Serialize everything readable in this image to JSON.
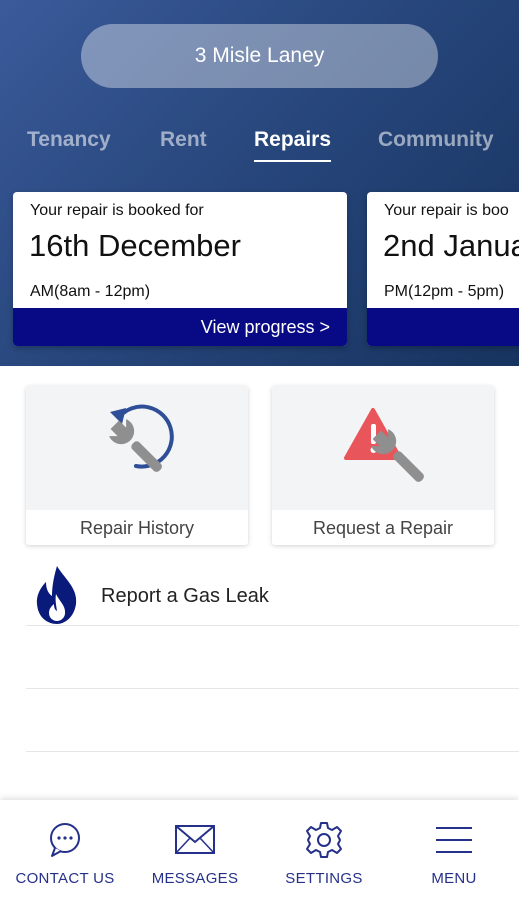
{
  "header": {
    "address": "3 Misle Laney"
  },
  "tabs": [
    {
      "label": "Tenancy",
      "active": false
    },
    {
      "label": "Rent",
      "active": false
    },
    {
      "label": "Repairs",
      "active": true
    },
    {
      "label": "Community",
      "active": false
    }
  ],
  "bookings": [
    {
      "label": "Your repair is booked for",
      "date": "16th December",
      "slot": "AM(8am - 12pm)",
      "action": "View progress >"
    },
    {
      "label": "Your repair is boo",
      "date": "2nd Janua",
      "slot": "PM(12pm - 5pm)",
      "action": ""
    }
  ],
  "tiles": [
    {
      "label": "Repair History",
      "icon": "repair-history-icon"
    },
    {
      "label": "Request a Repair",
      "icon": "request-repair-icon"
    }
  ],
  "list": [
    {
      "label": "Report a Gas Leak",
      "icon": "flame-icon"
    }
  ],
  "bottom_nav": [
    {
      "label": "CONTACT US",
      "icon": "chat-bubble-icon"
    },
    {
      "label": "MESSAGES",
      "icon": "envelope-icon"
    },
    {
      "label": "SETTINGS",
      "icon": "gear-icon"
    },
    {
      "label": "MENU",
      "icon": "hamburger-icon"
    }
  ],
  "colors": {
    "hero_start": "#3a5a9a",
    "hero_end": "#17335f",
    "action_bar": "#080a85",
    "nav_text": "#25308a",
    "flame": "#0a1a7a",
    "warning": "#e8555a"
  }
}
